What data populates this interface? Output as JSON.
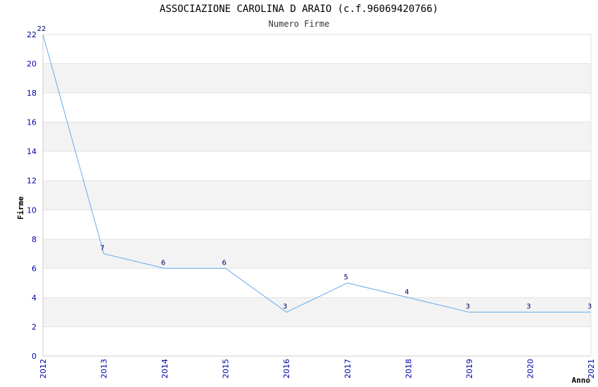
{
  "chart_data": {
    "type": "line",
    "title": "ASSOCIAZIONE CAROLINA D ARAIO (c.f.96069420766)",
    "subtitle": "Numero Firme",
    "xlabel": "Anno",
    "ylabel": "Firme",
    "x": [
      "2012",
      "2013",
      "2014",
      "2015",
      "2016",
      "2017",
      "2018",
      "2019",
      "2020",
      "2021"
    ],
    "series": [
      {
        "values": [
          22,
          7,
          6,
          6,
          3,
          5,
          4,
          3,
          3,
          3
        ]
      }
    ],
    "ylim": [
      0,
      22
    ],
    "yticks": [
      "0",
      "2",
      "4",
      "6",
      "8",
      "10",
      "12",
      "14",
      "16",
      "18",
      "20",
      "22"
    ],
    "grid": true,
    "banded_background": true,
    "line_color": "#66aaee",
    "band_color": "#f3f3f3",
    "tick_color": "#0000aa"
  }
}
